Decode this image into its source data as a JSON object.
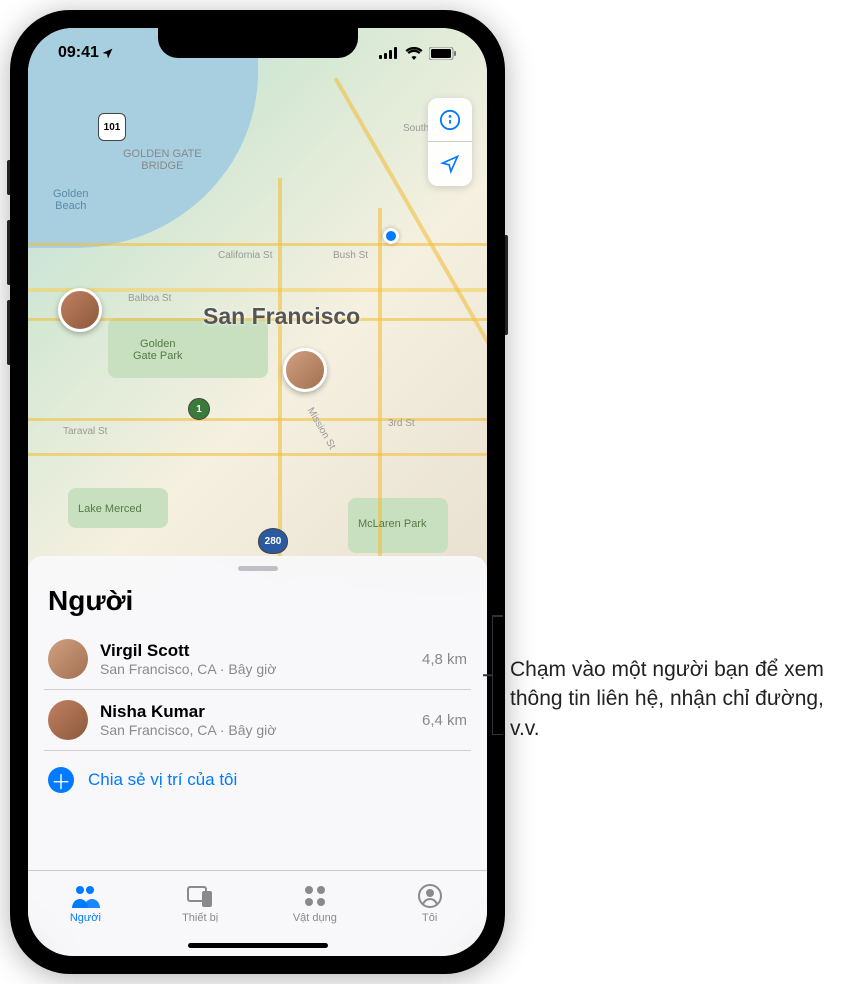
{
  "status": {
    "time": "09:41"
  },
  "map": {
    "city": "San Francisco",
    "labels": {
      "ggb": "GOLDEN GATE\nBRIDGE",
      "gb": "Golden\nBeach",
      "ggp": "Golden\nGate Park",
      "lm": "Lake Merced",
      "mp": "McLaren Park",
      "california": "California St",
      "bush": "Bush St",
      "balboa": "Balboa St",
      "taraval": "Taraval St",
      "mission": "Mission St",
      "third": "3rd St",
      "southferry": "South Ferry",
      "hwy101": "101",
      "hwy1": "1",
      "hwy280": "280"
    }
  },
  "sheet": {
    "title": "Người",
    "people": [
      {
        "name": "Virgil Scott",
        "location": "San Francisco, CA · Bây giờ",
        "distance": "4,8 km"
      },
      {
        "name": "Nisha Kumar",
        "location": "San Francisco, CA · Bây giờ",
        "distance": "6,4 km"
      }
    ],
    "share_label": "Chia sẻ vị trí của tôi"
  },
  "tabs": {
    "people": "Người",
    "devices": "Thiết bị",
    "items": "Vật dụng",
    "me": "Tôi"
  },
  "callout": {
    "text": "Chạm vào một người bạn để xem thông tin liên hệ, nhận chỉ đường, v.v."
  }
}
